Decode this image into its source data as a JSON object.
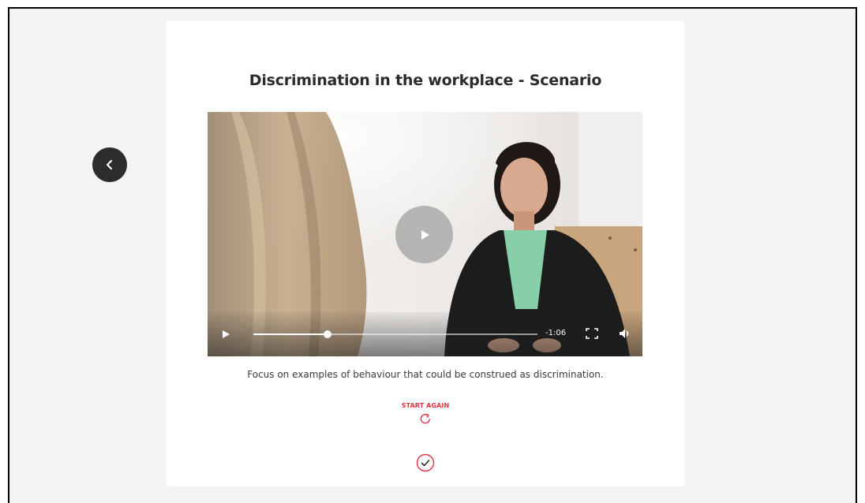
{
  "lesson": {
    "title": "Discrimination in the workplace - Scenario",
    "caption": "Focus on examples of behaviour that could be construed as discrimination.",
    "start_again_label": "START AGAIN"
  },
  "video": {
    "time_remaining": "-1:06",
    "progress_fraction": 0.26
  },
  "icons": {
    "back": "chevron-left-icon",
    "play_overlay": "play-icon",
    "play": "play-icon",
    "fullscreen": "fullscreen-icon",
    "volume": "volume-icon",
    "restart": "restart-icon",
    "complete": "check-circle-icon"
  },
  "colors": {
    "accent": "#e3323f",
    "page_background": "#f3f3f3",
    "back_button": "#2c2c2c"
  }
}
